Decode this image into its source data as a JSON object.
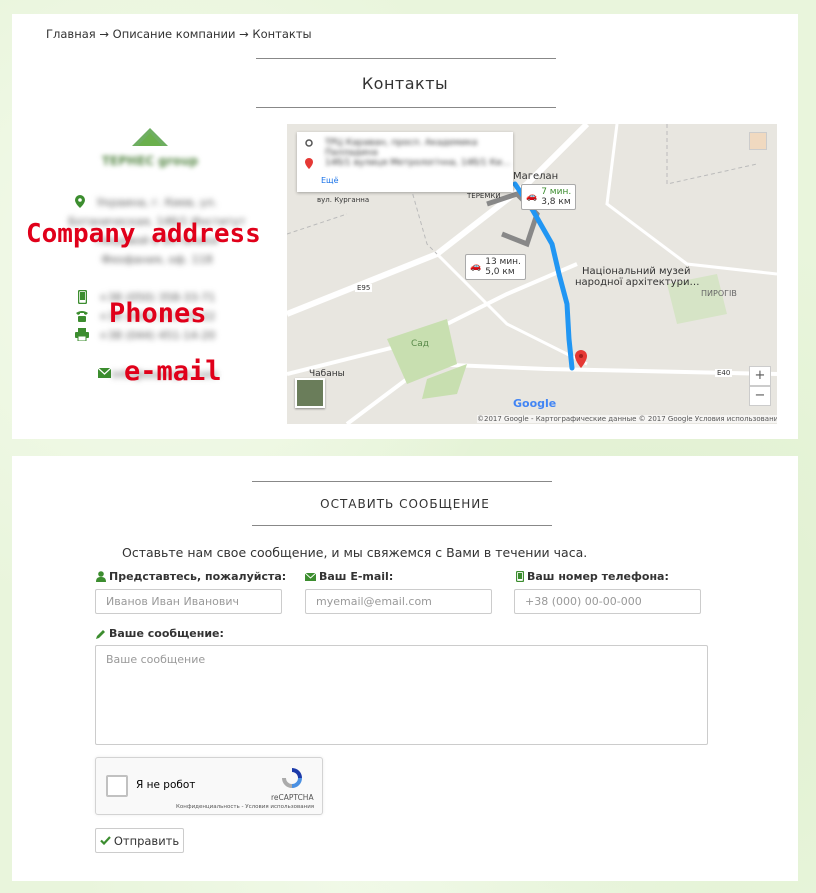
{
  "breadcrumb": {
    "items": [
      "Главная",
      "Описание компании",
      "Контакты"
    ],
    "separator": "→"
  },
  "page_title": "Контакты",
  "company": {
    "address_overlay": "Company address",
    "phones_overlay": "Phones",
    "email_overlay": "e-mail",
    "address_blurred": [
      "Украина, г. Киев, ул.",
      "Ботаническая, 14б/1 Институт",
      "Пищевой и Ботаники",
      "Феофания, оф. 118"
    ],
    "phones_blurred": [
      "+38 (050) 358-33-71",
      "+38 (044) 251-55-22",
      "+38 (044) 451-14-20"
    ],
    "email_blurred": "info@example.com",
    "logo_text": "TEPHEC group"
  },
  "map": {
    "route_from": "ТРЦ Караван, просп. Академика Палладина",
    "route_to": "14б/1 вулиця Метрологічна, 14б/1 Ки…",
    "more_link": "Ещё",
    "places": [
      "Магелан",
      "Національний музей",
      "народної архітектури…",
      "ПИРОГІВ",
      "Сад",
      "Чабаны",
      "вул. Курганна",
      "E95",
      "E40",
      "ТЕРЕМКИ"
    ],
    "route1_time": "7 мин.",
    "route1_dist": "3,8 км",
    "route2_time": "13 мин.",
    "route2_dist": "5,0 км",
    "footer": "©2017 Google - Картографические данные © 2017 Google    Условия использования",
    "google": "Google",
    "zoom_in": "+",
    "zoom_out": "−"
  },
  "form": {
    "section_title": "ОСТАВИТЬ СООБЩЕНИЕ",
    "intro": "Оставьте нам свое сообщение, и мы свяжемся с Вами в течении часа.",
    "name_label": "Представтесь, пожалуйста:",
    "name_placeholder": "Иванов Иван Иванович",
    "email_label": "Ваш E-mail:",
    "email_placeholder": "myemail@email.com",
    "phone_label": "Ваш номер телефона:",
    "phone_placeholder": "+38 (000) 00-00-000",
    "message_label": "Ваше сообщение:",
    "message_placeholder": "Ваше сообщение",
    "captcha_label": "Я не робот",
    "captcha_brand": "reCAPTCHA",
    "captcha_links": "Конфиденциальность - Условия использования",
    "submit_label": "Отправить"
  },
  "colors": {
    "accent_green": "#3c8d2f",
    "overlay_red": "#e0001a",
    "route_blue": "#2196f3"
  }
}
